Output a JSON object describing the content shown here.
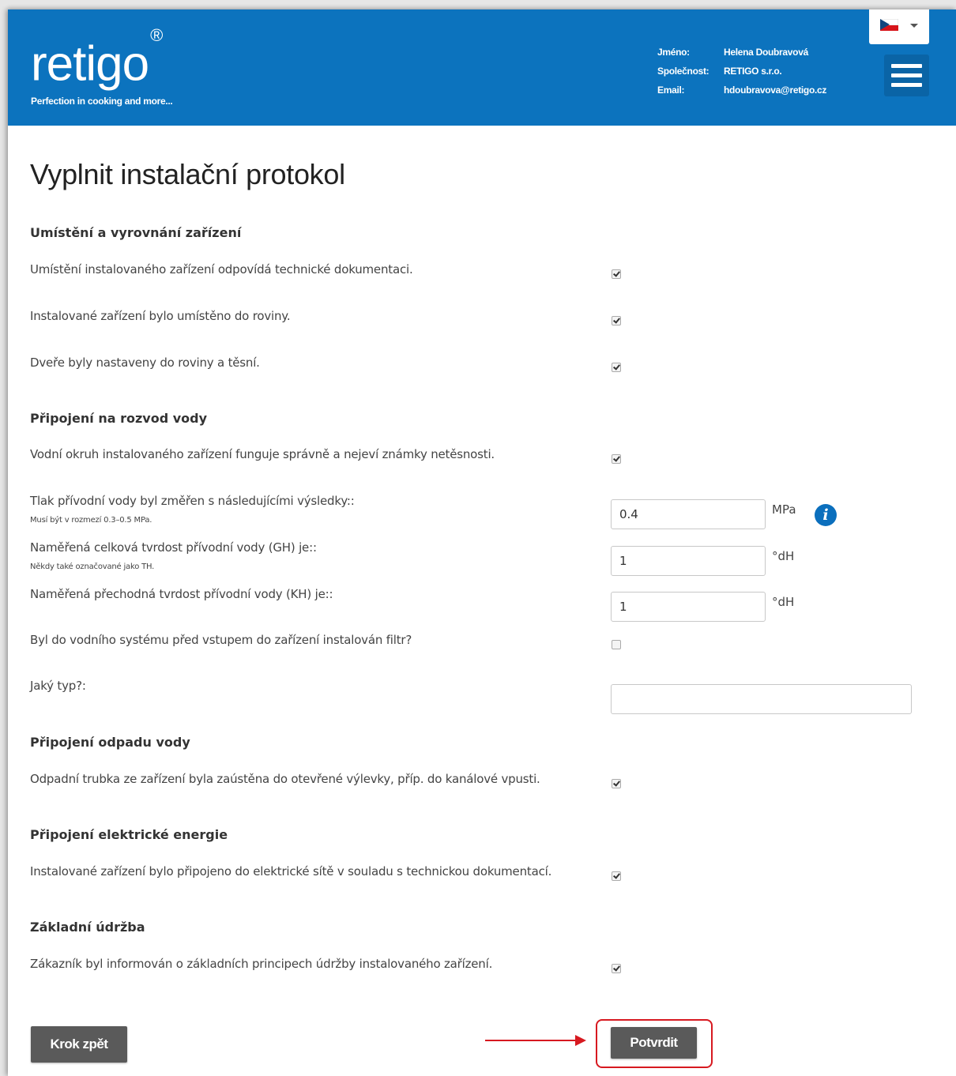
{
  "header": {
    "logo_text": "retigo",
    "logo_mark": "®",
    "tagline": "Perfection in cooking and more...",
    "user": {
      "name_label": "Jméno:",
      "name": "Helena Doubravová",
      "company_label": "Společnost:",
      "company": "RETIGO s.r.o.",
      "email_label": "Email:",
      "email": "hdoubravova@retigo.cz"
    },
    "language": {
      "icon": "czech-flag-icon",
      "selected": "cs"
    },
    "menu_icon": "hamburger-menu-icon",
    "accent_color": "#0c73be"
  },
  "page": {
    "title": "Vyplnit instalační protokol"
  },
  "sections": {
    "placement": {
      "title": "Umístění a vyrovnání zařízení",
      "q1": "Umístění instalovaného zařízení odpovídá technické dokumentaci.",
      "q2": "Instalované zařízení bylo umístěno do roviny.",
      "q3": "Dveře byly nastaveny do roviny a těsní."
    },
    "water": {
      "title": "Připojení na rozvod vody",
      "q1": "Vodní okruh instalovaného zařízení funguje správně a nejeví známky netěsnosti.",
      "pressure_label": "Tlak přívodní vody byl změřen s následujícími výsledky::",
      "pressure_hint": "Musí být v rozmezí 0.3–0.5 MPa.",
      "pressure_value": "0.4",
      "pressure_unit": "MPa",
      "gh_label": "Naměřená celková tvrdost přívodní vody (GH) je::",
      "gh_hint": "Někdy také označované jako TH.",
      "gh_value": "1",
      "gh_unit": "°dH",
      "kh_label": "Naměřená přechodná tvrdost přívodní vody (KH) je::",
      "kh_value": "1",
      "kh_unit": "°dH",
      "filter_label": "Byl do vodního systému před vstupem do zařízení instalován filtr?",
      "type_label": "Jaký typ?:",
      "type_value": ""
    },
    "drain": {
      "title": "Připojení odpadu vody",
      "q1": "Odpadní trubka ze zařízení byla zaústěna do otevřené výlevky, příp. do kanálové vpusti."
    },
    "electric": {
      "title": "Připojení elektrické energie",
      "q1": "Instalované zařízení bylo připojeno do elektrické sítě v souladu s technickou dokumentací."
    },
    "maintenance": {
      "title": "Základní údržba",
      "q1": "Zákazník byl informován o základních principech údržby instalovaného zařízení."
    }
  },
  "checkboxes": {
    "placement_q1": true,
    "placement_q2": true,
    "placement_q3": true,
    "water_q1": true,
    "filter": false,
    "drain_q1": true,
    "electric_q1": true,
    "maintenance_q1": true
  },
  "info_icon": {
    "icon": "info-icon",
    "glyph": "i"
  },
  "buttons": {
    "back": "Krok zpět",
    "confirm": "Potvrdit"
  },
  "annotation": {
    "color": "#d71920"
  }
}
